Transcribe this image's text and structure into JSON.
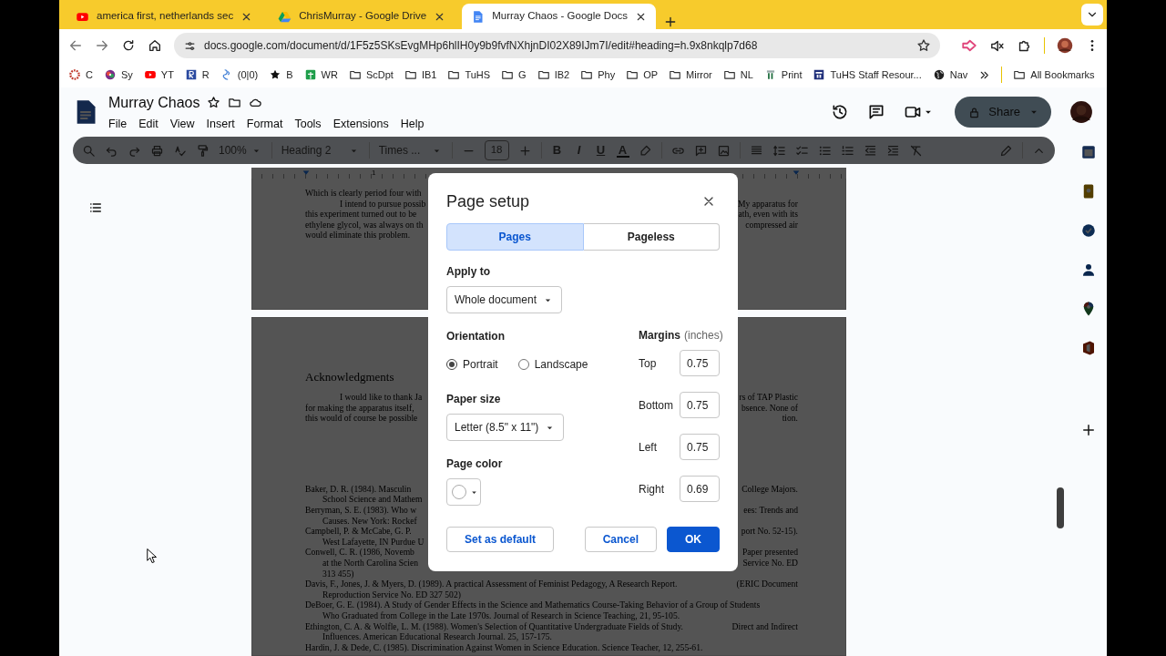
{
  "browser": {
    "tabs": [
      {
        "title": "america first, netherlands sec",
        "selected": false
      },
      {
        "title": "ChrisMurray - Google Drive",
        "selected": false
      },
      {
        "title": "Murray Chaos - Google Docs",
        "selected": true
      }
    ],
    "address": "docs.google.com/document/d/1F5z5SKsEvgMHp6hlIH0y9b9fvfNXhjnDI02X89IJm7I/edit#heading=h.9x8nkqlp7d68",
    "bookmarks": [
      "C",
      "Sy",
      "YT",
      "R",
      "(0|0)",
      "B",
      "WR",
      "ScDpt",
      "IB1",
      "TuHS",
      "G",
      "IB2",
      "Phy",
      "OP",
      "Mirror",
      "NL",
      "Print",
      "TuHS Staff Resour...",
      "Nav"
    ],
    "all_bookmarks": "All Bookmarks"
  },
  "docs": {
    "title": "Murray Chaos",
    "menu": [
      "File",
      "Edit",
      "View",
      "Insert",
      "Format",
      "Tools",
      "Extensions",
      "Help"
    ],
    "zoom": "100%",
    "style": "Heading 2",
    "font": "Times ...",
    "font_size": "18",
    "format_letters": [
      "B",
      "I",
      "U",
      "A"
    ],
    "share": "Share",
    "ruler_label": "1"
  },
  "document": {
    "page1": [
      {
        "kind": "para",
        "left": "Which is clearly period four with"
      },
      {
        "kind": "first",
        "left": "I intend to pursue possib",
        "right": "My apparatus for"
      },
      {
        "kind": "para",
        "left": "this experiment turned out to be",
        "right": "ath, even with its"
      },
      {
        "kind": "para",
        "left": "ethylene glycol, was always on th",
        "right": "compressed air"
      },
      {
        "kind": "para",
        "left": "would eliminate this problem."
      }
    ],
    "heading": "Acknowledgments",
    "page2": [
      {
        "kind": "first",
        "left": "I would like to thank Ja",
        "right": "rs of TAP Plastic"
      },
      {
        "kind": "para",
        "left": "for making the apparatus itself,",
        "right": "bsence.  None of"
      },
      {
        "kind": "para",
        "left": "this would of course be possible",
        "right": "tion."
      }
    ],
    "references": [
      {
        "kind": "ref",
        "left": "Baker, D. R.  (1984).  Masculin",
        "right": "College Majors."
      },
      {
        "kind": "cont",
        "left": "School Science and Mathem"
      },
      {
        "kind": "ref",
        "left": "Berryman, S. E.  (1983).  Who w",
        "right": "ees:  Trends and"
      },
      {
        "kind": "cont",
        "left": "Causes.  New York: Rockef"
      },
      {
        "kind": "ref",
        "left": "Campbell, P. & McCabe, G. P.",
        "right": "port No. 52-15)."
      },
      {
        "kind": "cont",
        "left": "West Lafayette, IN Purdue U"
      },
      {
        "kind": "ref",
        "left": "Conwell, C. R.  (1986, Novemb",
        "right": "Paper presented"
      },
      {
        "kind": "cont",
        "left": "at the North Carolina Scien",
        "right": "Service No. ED"
      },
      {
        "kind": "cont",
        "left": "313 455)"
      },
      {
        "kind": "ref",
        "left": "Davis, F., Jones, J. & Myers, D.  (1989).  A practical Assessment of Feminist Pedagogy, A Research Report.",
        "right": "(ERIC Document"
      },
      {
        "kind": "cont",
        "left": "Reproduction Service No. ED 327 502)"
      },
      {
        "kind": "ref",
        "left": "DeBoer, G. E.  (1984).  A Study of Gender Effects in the Science and Mathematics Course-Taking Behavior of a Group of Students"
      },
      {
        "kind": "cont",
        "left": "Who Graduated from College in the Late 1970s.  Journal of Research in Science Teaching, 21, 95-105."
      },
      {
        "kind": "ref",
        "left": "Ethington, C. A. & Wolfle, L. M.  (1988).  Women's Selection of Quantitative Undergraduate Fields of Study.",
        "right": "Direct and Indirect"
      },
      {
        "kind": "cont",
        "left": "Influences.  American Educational Research Journal. 25, 157-175."
      },
      {
        "kind": "ref",
        "left": "Hardin, J. & Dede, C.  (1985).  Discrimination Against Women in Science Education.  Science Teacher, 12, 255-61."
      }
    ]
  },
  "dialog": {
    "title": "Page setup",
    "tabs": [
      {
        "label": "Pages",
        "selected": true
      },
      {
        "label": "Pageless",
        "selected": false
      }
    ],
    "apply_label": "Apply to",
    "apply_value": "Whole document",
    "orientation_label": "Orientation",
    "orientations": [
      {
        "label": "Portrait",
        "selected": true
      },
      {
        "label": "Landscape",
        "selected": false
      }
    ],
    "paper_label": "Paper size",
    "paper_value": "Letter (8.5\" x 11\")",
    "color_label": "Page color",
    "margins_label": "Margins",
    "margins_unit": "(inches)",
    "margins": [
      {
        "label": "Top",
        "value": "0.75"
      },
      {
        "label": "Bottom",
        "value": "0.75"
      },
      {
        "label": "Left",
        "value": "0.75"
      },
      {
        "label": "Right",
        "value": "0.69"
      }
    ],
    "buttons": [
      {
        "label": "Set as default",
        "kind": "outline"
      },
      {
        "label": "Cancel",
        "kind": "outline"
      },
      {
        "label": "OK",
        "kind": "primary"
      }
    ]
  }
}
